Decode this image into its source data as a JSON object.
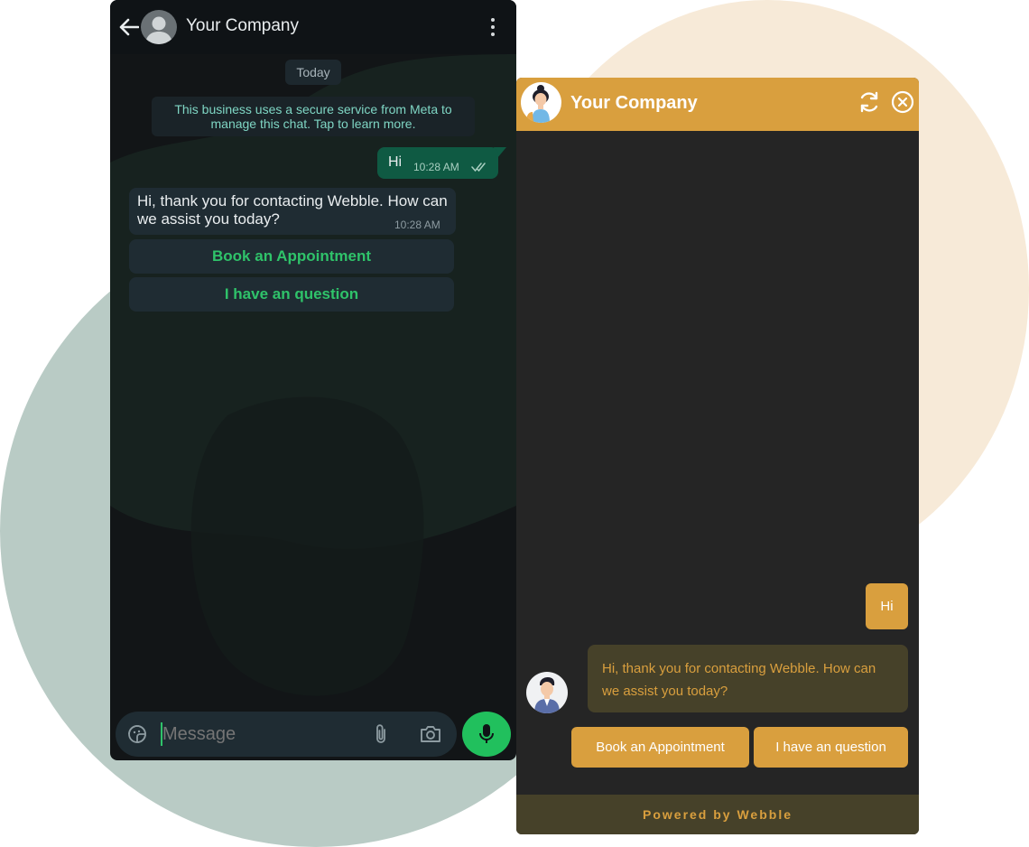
{
  "whatsapp": {
    "header": {
      "title": "Your Company",
      "back_icon": "arrow-left-icon",
      "menu_icon": "kebab-menu-icon"
    },
    "date_chip": "Today",
    "notice": "This business uses a secure service from Meta to manage this chat. Tap to learn more.",
    "messages": [
      {
        "direction": "outgoing",
        "text": "Hi",
        "time": "10:28 AM",
        "status": "read"
      },
      {
        "direction": "incoming",
        "text": "Hi, thank you for contacting Webble. How can we assist you today?",
        "time": "10:28 AM"
      }
    ],
    "quick_replies": [
      "Book an Appointment",
      "I have an question"
    ],
    "composer": {
      "placeholder": "Message"
    },
    "colors": {
      "background": "#121517",
      "accent": "#21c05d",
      "outgoing_bubble": "#0f5a43",
      "incoming_bubble": "#1f2c33"
    }
  },
  "webble": {
    "header": {
      "title": "Your Company",
      "refresh_icon": "refresh-icon",
      "close_icon": "close-circle-icon"
    },
    "messages": [
      {
        "direction": "outgoing",
        "text": "Hi"
      },
      {
        "direction": "incoming",
        "text": "Hi, thank you for contacting Webble. How can we assist you today?"
      }
    ],
    "quick_replies": [
      "Book an Appointment",
      "I have an question"
    ],
    "footer": "Powered by Webble",
    "colors": {
      "accent": "#d99f3e",
      "background": "#252525",
      "bot_bubble": "#464129"
    }
  }
}
